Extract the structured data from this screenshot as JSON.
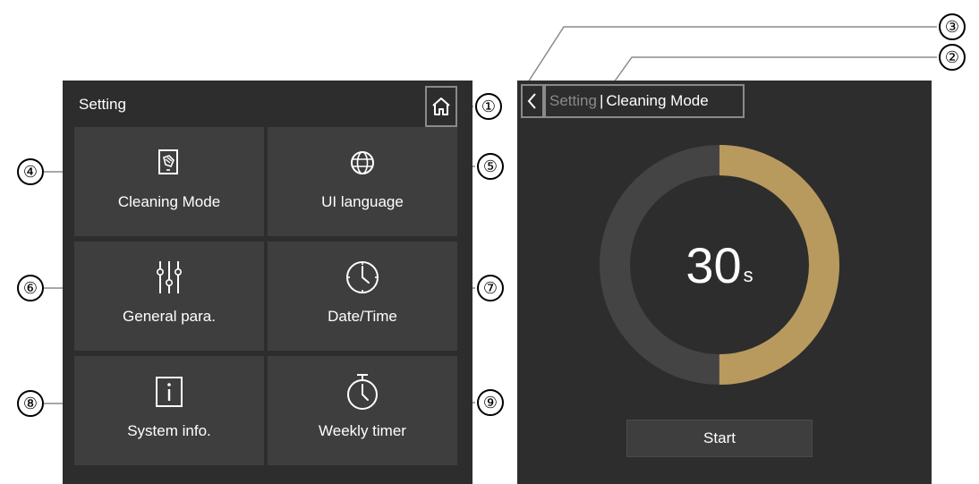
{
  "left_panel": {
    "title": "Setting",
    "home_button": {
      "icon": "home-icon"
    },
    "tiles": [
      {
        "label": "Cleaning Mode",
        "icon": "cleaning-mode-icon"
      },
      {
        "label": "UI language",
        "icon": "globe-icon"
      },
      {
        "label": "General para.",
        "icon": "sliders-icon"
      },
      {
        "label": "Date/Time",
        "icon": "clock-icon"
      },
      {
        "label": "System info.",
        "icon": "info-icon"
      },
      {
        "label": "Weekly timer",
        "icon": "stopwatch-icon"
      }
    ]
  },
  "right_panel": {
    "back_button": {
      "icon": "chevron-left-icon"
    },
    "breadcrumb": {
      "parent": "Setting",
      "separator": "|",
      "current": "Cleaning Mode"
    },
    "timer": {
      "value": "30",
      "unit": "s",
      "progress_fraction": 0.5
    },
    "start_label": "Start"
  },
  "callouts": [
    "①",
    "②",
    "③",
    "④",
    "⑤",
    "⑥",
    "⑦",
    "⑧",
    "⑨"
  ],
  "colors": {
    "panel_bg": "#2d2d2d",
    "tile_bg": "#3e3e3e",
    "ring_track": "#444444",
    "ring_progress": "#b89a5e",
    "text": "#ffffff",
    "muted_text": "#8a8a8a"
  }
}
